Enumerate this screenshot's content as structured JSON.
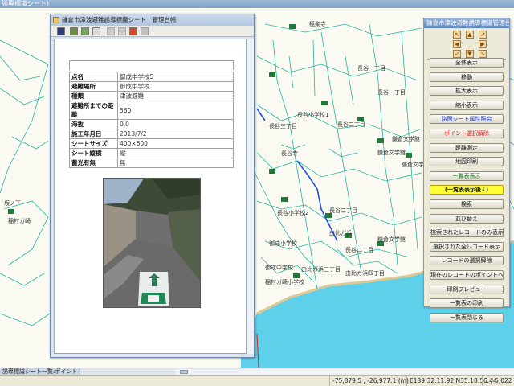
{
  "app": {
    "title_partial": "誘導標識シート)"
  },
  "attribute_window": {
    "title": "鎌倉市津波避難誘導標識シート　管理台帳",
    "toolbar_icons": [
      "save-icon",
      "print-icon",
      "print-preview-icon",
      "copy-icon",
      "grid-icon",
      "list-icon",
      "close-arrow-icon",
      "link-icon"
    ],
    "rows": [
      {
        "key": "点名",
        "value": "御成中学校5"
      },
      {
        "key": "避難場所",
        "value": "御成中学校"
      },
      {
        "key": "種類",
        "value": "津波避難"
      },
      {
        "key": "避難所までの距離",
        "value": "560"
      },
      {
        "key": "海抜",
        "value": "0.0"
      },
      {
        "key": "施工年月日",
        "value": "2013/7/2"
      },
      {
        "key": "シートサイズ",
        "value": "400×600"
      },
      {
        "key": "シート縦横",
        "value": "縦"
      },
      {
        "key": "蓄光有無",
        "value": "無"
      }
    ]
  },
  "control_panel": {
    "title": "鎌倉市津波避難誘導標識管理台帳",
    "arrows": [
      "↖",
      "▲",
      "↗",
      "◀",
      "▶",
      "↙",
      "▼",
      "↘"
    ],
    "buttons": [
      {
        "label": "全体表示",
        "style": "normal"
      },
      {
        "label": "移動",
        "style": "normal"
      },
      {
        "label": "拡大表示",
        "style": "normal"
      },
      {
        "label": "縮小表示",
        "style": "normal"
      },
      {
        "label": "路面シート属性照会",
        "style": "blue"
      },
      {
        "label": "ポイント選択解除",
        "style": "red"
      },
      {
        "label": "距離測定",
        "style": "normal"
      },
      {
        "label": "地図印刷",
        "style": "normal"
      },
      {
        "label": "一覧表表示",
        "style": "green"
      },
      {
        "label": "(一覧表表示後↓)",
        "style": "yellow"
      },
      {
        "label": "検索",
        "style": "normal"
      },
      {
        "label": "並び替え",
        "style": "normal"
      },
      {
        "label": "検索されたレコードのみ表示",
        "style": "normal"
      },
      {
        "label": "選択された全レコード表示",
        "style": "normal"
      },
      {
        "label": "レコードの選択解除",
        "style": "normal"
      },
      {
        "label": "現在のレコードのポイントへ",
        "style": "normal"
      },
      {
        "label": "印刷プレビュー",
        "style": "normal"
      },
      {
        "label": "一覧表の印刷",
        "style": "normal"
      },
      {
        "label": "一覧表閉じる",
        "style": "normal"
      }
    ]
  },
  "map_labels": {
    "l1": "長谷一丁目",
    "l2": "長谷一丁目",
    "l3": "長谷二丁目",
    "l4": "長谷二丁目",
    "l5": "長谷二丁目",
    "l6": "長谷三丁目",
    "l7": "坂ノ下",
    "l8": "稲村ガ崎",
    "l9": "長谷小学校1",
    "l10": "長谷小学校2",
    "l11": "御成小学校",
    "l12": "鎌倉文学館",
    "l13": "鎌倉文学館",
    "l14": "鎌倉文学館",
    "l15": "鎌倉文学館",
    "l16": "由比ガ浜",
    "l17": "由比ガ浜三丁目",
    "l18": "由比ガ浜四丁目",
    "l19": "長谷寺",
    "l20": "極楽寺",
    "l21": "御成中学校",
    "l22": "稲村ガ崎小学校"
  },
  "tabs": {
    "list_tab": "誘導標識シート一覧:ポイント"
  },
  "status": {
    "coords_m": "-75,879.5 , -26,977.1 (m)",
    "coords_geo": "E139:32:11.92 N35:18:56.44",
    "record": "1 / 5,022"
  },
  "colors": {
    "sea": "#5fd0ea",
    "roads": "#2ab4a0",
    "panel_bg": "#ece9d8",
    "title_bar": "#7fa2c8"
  }
}
